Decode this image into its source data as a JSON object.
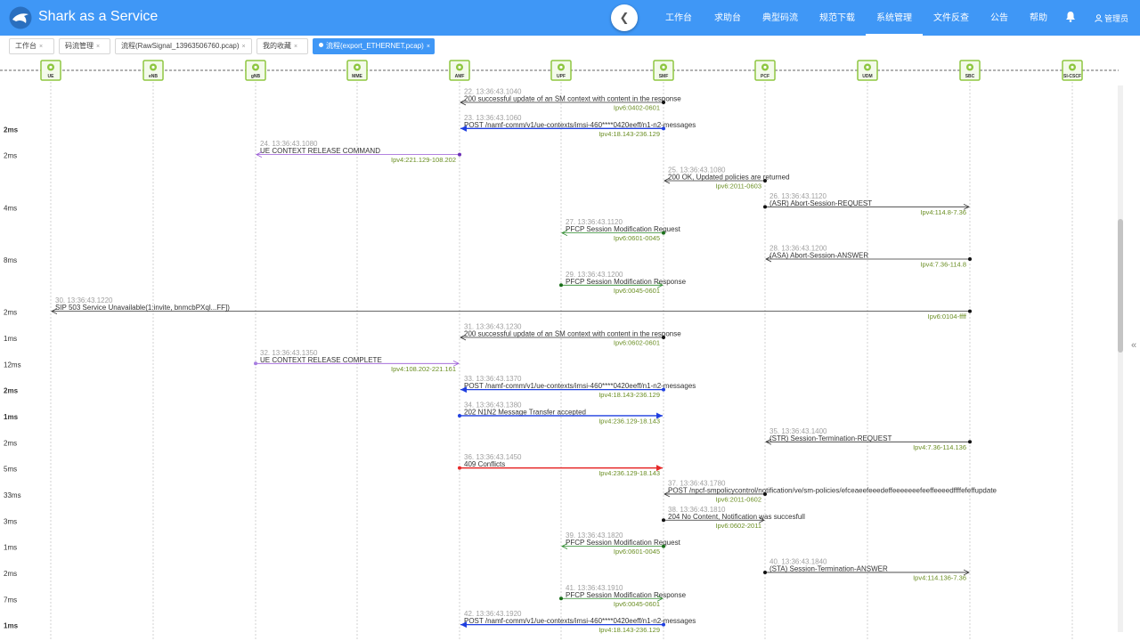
{
  "app": {
    "title": "Shark as a Service"
  },
  "nav": {
    "items": [
      "工作台",
      "求助台",
      "典型码流",
      "规范下载",
      "系统管理",
      "文件反查",
      "公告",
      "帮助"
    ],
    "active_index": 4,
    "user": "管理员"
  },
  "tabs": [
    {
      "label": "工作台",
      "closable": true,
      "active": false
    },
    {
      "label": "码流管理",
      "closable": true,
      "active": false
    },
    {
      "label": "流程(RawSignal_13963506760.pcap)",
      "closable": true,
      "active": false
    },
    {
      "label": "我的收藏",
      "closable": true,
      "active": false
    },
    {
      "label": "流程(export_ETHERNET.pcap)",
      "closable": true,
      "active": true
    }
  ],
  "icons": {
    "logo": "shark-logo-icon",
    "collapse": "chevron-left-icon",
    "bell": "bell-icon",
    "user": "user-icon",
    "node": "network-element-icon",
    "side": "double-chevron-left-icon"
  },
  "colors": {
    "accent": "#3f97f6",
    "node": "#8dc63f",
    "error": "#e62828",
    "blue_msg": "#1f3fe0",
    "ip": "#6a8e23"
  },
  "nodes": [
    "UE",
    "eNB",
    "gNB",
    "MME",
    "AMF",
    "UPF",
    "SMF",
    "PCF",
    "UDM",
    "SBC",
    "SI-CSCF"
  ],
  "messages": [
    {
      "ts": "22. 13:36:43.1040",
      "text": "200 successful update of an SM context with content in the response",
      "ip": "Ipv6:0402-0601",
      "from": "SMF",
      "to": "AMF",
      "dur": "",
      "style": "reply"
    },
    {
      "ts": "23. 13:36:43.1060",
      "text": "POST /namf-comm/v1/ue-contexts/imsi-460****0420eeff/n1-n2-messages",
      "ip": "Ipv4:18.143-236.129",
      "from": "SMF",
      "to": "AMF",
      "dur": "2ms",
      "style": "blue"
    },
    {
      "ts": "24. 13:36:43.1080",
      "text": "UE CONTEXT RELEASE COMMAND",
      "ip": "Ipv4:221.129-108.202",
      "from": "AMF",
      "to": "gNB",
      "dur": "2ms",
      "style": "purple"
    },
    {
      "ts": "25. 13:36:43.1080",
      "text": "200 OK, Updated policies are returned",
      "ip": "Ipv6:2011-0603",
      "from": "PCF",
      "to": "SMF",
      "dur": "",
      "style": "reply"
    },
    {
      "ts": "26. 13:36:43.1120",
      "text": "(ASR) Abort-Session-REQUEST",
      "ip": "Ipv4:114.8-7.36",
      "from": "PCF",
      "to": "SBC",
      "dur": "4ms",
      "style": "request"
    },
    {
      "ts": "27. 13:36:43.1120",
      "text": "PFCP Session Modification Request",
      "ip": "Ipv6:0601-0045",
      "from": "SMF",
      "to": "UPF",
      "dur": "",
      "style": "green-reply"
    },
    {
      "ts": "28. 13:36:43.1200",
      "text": "(ASA) Abort-Session-ANSWER",
      "ip": "Ipv4:7.36-114.8",
      "from": "SBC",
      "to": "PCF",
      "dur": "8ms",
      "style": "reply"
    },
    {
      "ts": "29. 13:36:43.1200",
      "text": "PFCP Session Modification Response",
      "ip": "Ipv6:0045-0601",
      "from": "UPF",
      "to": "SMF",
      "dur": "",
      "style": "green-request"
    },
    {
      "ts": "30. 13:36:43.1220",
      "text": "SIP 503 Service Unavailable(1:invite, bnmcbPXql...FF])",
      "ip": "Ipv6:0104-ffff",
      "from": "SBC",
      "to": "UE",
      "dur": "2ms",
      "style": "reply"
    },
    {
      "ts": "31. 13:36:43.1230",
      "text": "200 successful update of an SM context with content in the response",
      "ip": "Ipv6:0602-0601",
      "from": "SMF",
      "to": "AMF",
      "dur": "1ms",
      "style": "reply"
    },
    {
      "ts": "32. 13:36:43.1350",
      "text": "UE CONTEXT RELEASE COMPLETE",
      "ip": "Ipv4:108.202-221.161",
      "from": "gNB",
      "to": "AMF",
      "dur": "12ms",
      "style": "purple-request"
    },
    {
      "ts": "33. 13:36:43.1370",
      "text": "POST /namf-comm/v1/ue-contexts/imsi-460****0420eeff/n1-n2-messages",
      "ip": "Ipv4:18.143-236.129",
      "from": "SMF",
      "to": "AMF",
      "dur": "2ms",
      "style": "blue"
    },
    {
      "ts": "34. 13:36:43.1380",
      "text": "202 N1N2 Message Transfer accepted",
      "ip": "Ipv4:236.129-18.143",
      "from": "AMF",
      "to": "SMF",
      "dur": "1ms",
      "style": "blue"
    },
    {
      "ts": "35. 13:36:43.1400",
      "text": "(STR) Session-Termination-REQUEST",
      "ip": "Ipv4:7.36-114.136",
      "from": "SBC",
      "to": "PCF",
      "dur": "2ms",
      "style": "reply"
    },
    {
      "ts": "36. 13:36:43.1450",
      "text": "409 Conflicts",
      "ip": "Ipv4:236.129-18.143",
      "from": "AMF",
      "to": "SMF",
      "dur": "5ms",
      "style": "error"
    },
    {
      "ts": "37. 13:36:43.1780",
      "text": "POST /npcf-smpolicycontrol/notification/ve/sm-policies/efceaeefeeedeffeeeeeeefeeffeeeedffffefeffupdate",
      "ip": "Ipv6:2011-0602",
      "from": "PCF",
      "to": "SMF",
      "dur": "33ms",
      "style": "reply"
    },
    {
      "ts": "38. 13:36:43.1810",
      "text": "204 No Content, Notification was succesfull",
      "ip": "Ipv6:0602-2011",
      "from": "SMF",
      "to": "PCF",
      "dur": "3ms",
      "style": "request"
    },
    {
      "ts": "39. 13:36:43.1820",
      "text": "PFCP Session Modification Request",
      "ip": "Ipv6:0601-0045",
      "from": "SMF",
      "to": "UPF",
      "dur": "1ms",
      "style": "green-reply"
    },
    {
      "ts": "40. 13:36:43.1840",
      "text": "(STA) Session-Termination-ANSWER",
      "ip": "Ipv4:114.136-7.36",
      "from": "PCF",
      "to": "SBC",
      "dur": "2ms",
      "style": "request"
    },
    {
      "ts": "41. 13:36:43.1910",
      "text": "PFCP Session Modification Response",
      "ip": "Ipv6:0045-0601",
      "from": "UPF",
      "to": "SMF",
      "dur": "7ms",
      "style": "green-request"
    },
    {
      "ts": "42. 13:36:43.1920",
      "text": "POST /namf-comm/v1/ue-contexts/imsi-460****0420eeff/n1-n2-messages",
      "ip": "Ipv4:18.143-236.129",
      "from": "SMF",
      "to": "AMF",
      "dur": "1ms",
      "style": "blue"
    }
  ]
}
